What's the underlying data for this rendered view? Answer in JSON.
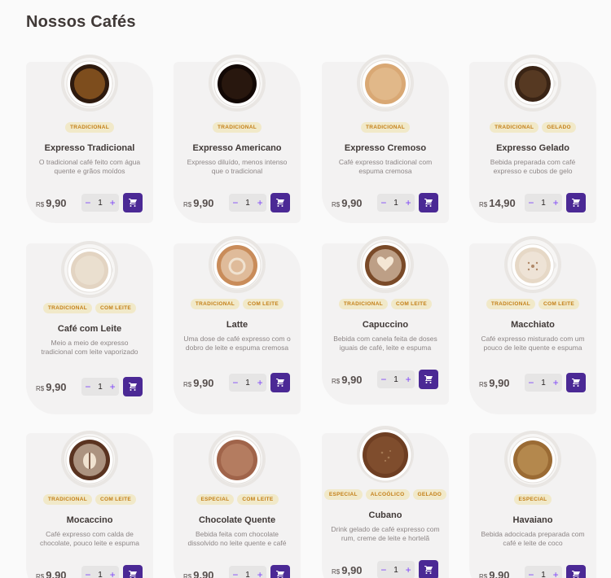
{
  "page": {
    "title": "Nossos Cafés"
  },
  "colors": {
    "accent": "#4B2995",
    "tag_bg": "#F1E9C9",
    "tag_text": "#C47F17",
    "card_bg": "#F3F2F2"
  },
  "currency": "R$",
  "products": [
    {
      "name": "Expresso Tradicional",
      "description": "O tradicional café feito com água quente e grãos moídos",
      "tags": [
        "TRADICIONAL"
      ],
      "price": "9,90",
      "quantity": "1",
      "cup": "espresso"
    },
    {
      "name": "Expresso Americano",
      "description": "Expresso diluído, menos intenso que o tradicional",
      "tags": [
        "TRADICIONAL"
      ],
      "price": "9,90",
      "quantity": "1",
      "cup": "americano"
    },
    {
      "name": "Expresso Cremoso",
      "description": "Café expresso tradicional com espuma cremosa",
      "tags": [
        "TRADICIONAL"
      ],
      "price": "9,90",
      "quantity": "1",
      "cup": "cremoso"
    },
    {
      "name": "Expresso Gelado",
      "description": "Bebida preparada com café expresso e cubos de gelo",
      "tags": [
        "TRADICIONAL",
        "GELADO"
      ],
      "price": "14,90",
      "quantity": "1",
      "cup": "gelado"
    },
    {
      "name": "Café com Leite",
      "description": "Meio a meio de expresso tradicional com leite vaporizado",
      "tags": [
        "TRADICIONAL",
        "COM LEITE"
      ],
      "price": "9,90",
      "quantity": "1",
      "cup": "leite"
    },
    {
      "name": "Latte",
      "description": "Uma dose de café expresso com o dobro de leite e espuma cremosa",
      "tags": [
        "TRADICIONAL",
        "COM LEITE"
      ],
      "price": "9,90",
      "quantity": "1",
      "cup": "latte"
    },
    {
      "name": "Capuccino",
      "description": "Bebida com canela feita de doses iguais de café, leite e espuma",
      "tags": [
        "TRADICIONAL",
        "COM LEITE"
      ],
      "price": "9,90",
      "quantity": "1",
      "cup": "capuccino"
    },
    {
      "name": "Macchiato",
      "description": "Café expresso misturado com um pouco de leite quente e espuma",
      "tags": [
        "TRADICIONAL",
        "COM LEITE"
      ],
      "price": "9,90",
      "quantity": "1",
      "cup": "macchiato"
    },
    {
      "name": "Mocaccino",
      "description": "Café expresso com calda de chocolate, pouco leite e espuma",
      "tags": [
        "TRADICIONAL",
        "COM LEITE"
      ],
      "price": "9,90",
      "quantity": "1",
      "cup": "mocaccino"
    },
    {
      "name": "Chocolate Quente",
      "description": "Bebida feita com chocolate dissolvido no leite quente e café",
      "tags": [
        "ESPECIAL",
        "COM LEITE"
      ],
      "price": "9,90",
      "quantity": "1",
      "cup": "chocolate"
    },
    {
      "name": "Cubano",
      "description": "Drink gelado de café expresso com rum, creme de leite e hortelã",
      "tags": [
        "ESPECIAL",
        "ALCOÓLICO",
        "GELADO"
      ],
      "price": "9,90",
      "quantity": "1",
      "cup": "cubano"
    },
    {
      "name": "Havaiano",
      "description": "Bebida adocicada preparada com café e leite de coco",
      "tags": [
        "ESPECIAL"
      ],
      "price": "9,90",
      "quantity": "1",
      "cup": "havaiano"
    }
  ]
}
